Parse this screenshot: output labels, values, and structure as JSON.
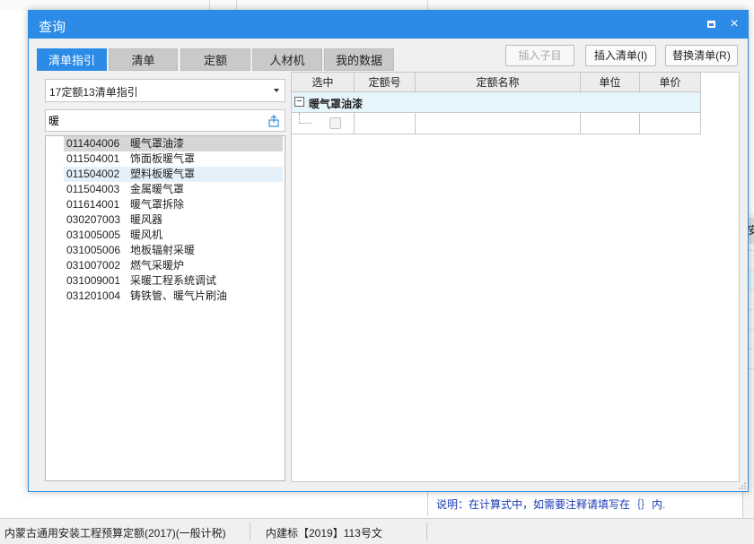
{
  "dialog": {
    "title": "查询",
    "maximize_label": "□",
    "close_label": "×"
  },
  "tabs": [
    {
      "label": "清单指引",
      "active": true
    },
    {
      "label": "清单",
      "active": false
    },
    {
      "label": "定额",
      "active": false
    },
    {
      "label": "人材机",
      "active": false
    },
    {
      "label": "我的数据",
      "active": false
    }
  ],
  "buttons": {
    "insert_child": "插入子目",
    "insert_list": "插入清单(I)",
    "replace_list": "替换清单(R)"
  },
  "left": {
    "library_select": "17定额13清单指引",
    "search_value": "暖",
    "items": [
      {
        "code": "011404006",
        "name": "暖气罩油漆"
      },
      {
        "code": "011504001",
        "name": "饰面板暖气罩"
      },
      {
        "code": "011504002",
        "name": "塑料板暖气罩"
      },
      {
        "code": "011504003",
        "name": "金属暖气罩"
      },
      {
        "code": "011614001",
        "name": "暖气罩拆除"
      },
      {
        "code": "030207003",
        "name": "暖风器"
      },
      {
        "code": "031005005",
        "name": "暖风机"
      },
      {
        "code": "031005006",
        "name": "地板辐射采暖"
      },
      {
        "code": "031007002",
        "name": "燃气采暖炉"
      },
      {
        "code": "031009001",
        "name": "采暖工程系统调试"
      },
      {
        "code": "031201004",
        "name": "铸铁管、暖气片刷油"
      }
    ],
    "selected_index": 0,
    "hover_index": 2
  },
  "grid": {
    "headers": [
      "选中",
      "定额号",
      "定额名称",
      "单位",
      "单价"
    ],
    "group_title": "暖气罩油漆",
    "collapse_symbol": "−"
  },
  "background": {
    "note": "说明：在计算式中，如需要注释请填写在｛｝内.",
    "right_header": "安",
    "status": [
      "内蒙古通用安装工程预算定额(2017)(一般计税)",
      "内建标【2019】113号文"
    ]
  },
  "colors": {
    "accent": "#2b8be6",
    "selected_row": "#d6d6d6",
    "hover_row": "#e4f1fb",
    "group_row": "#e6f4fb",
    "note_text": "#1a3bb3"
  }
}
